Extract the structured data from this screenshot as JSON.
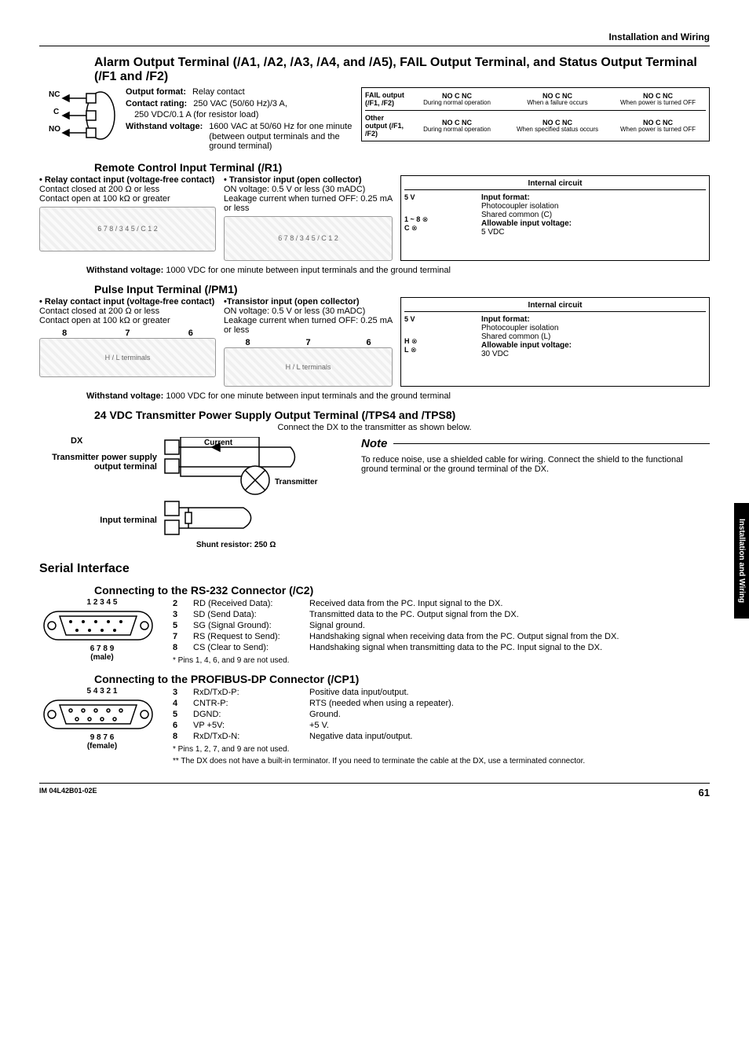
{
  "header": {
    "section": "Installation and Wiring"
  },
  "alarm": {
    "title": "Alarm Output Terminal (/A1, /A2, /A3, /A4, and /A5), FAIL Output Terminal, and Status Output Terminal (/F1 and /F2)",
    "labels": {
      "nc": "NC",
      "c": "C",
      "no": "NO"
    },
    "spec": {
      "output_format_k": "Output format:",
      "output_format_v": "Relay contact",
      "contact_rating_k": "Contact rating:",
      "contact_rating_v1": "250 VAC (50/60 Hz)/3 A,",
      "contact_rating_v2": "250 VDC/0.1 A (for resistor load)",
      "withstand_k": "Withstand voltage:",
      "withstand_v": "1600 VAC at 50/60 Hz for one minute (between output terminals and the ground terminal)"
    },
    "table": {
      "row1_lab": "FAIL output (/F1, /F2)",
      "row2_lab": "Other output (/F1, /F2)",
      "hdr": "NO C NC",
      "c1_1": "During normal operation",
      "c1_2": "When a failure occurs",
      "c1_3": "When power is turned OFF",
      "c2_1": "During normal operation",
      "c2_2": "When specified status occurs",
      "c2_3": "When power is turned OFF"
    }
  },
  "remote": {
    "title": "Remote Control Input Terminal (/R1)",
    "relay_k": "• Relay contact input (voltage-free contact)",
    "relay_v1": "Contact closed at 200 Ω or less",
    "relay_v2": "Contact open at 100 kΩ or greater",
    "trans_k": "• Transistor input (open collector)",
    "trans_v1": "ON voltage: 0.5 V or less (30 mADC)",
    "trans_v2": "Leakage current when turned OFF: 0.25 mA or less",
    "pins": {
      "c": "C",
      "1": "1",
      "2": "2",
      "3": "3",
      "4": "4",
      "5": "5",
      "6": "6",
      "7": "7",
      "8": "8"
    },
    "internal": {
      "title": "Internal circuit",
      "v5": "5 V",
      "range": "1 ~ 8",
      "c": "C",
      "fmt_k": "Input format:",
      "fmt_v1": "Photocoupler isolation",
      "fmt_v2": "Shared common (C)",
      "aiv_k": "Allowable input voltage:",
      "aiv_v": "5 VDC"
    },
    "withstand_k": "Withstand voltage:",
    "withstand_v": "1000 VDC for one minute between input terminals and the ground terminal"
  },
  "pulse": {
    "title": "Pulse Input Terminal (/PM1)",
    "relay_k": "• Relay contact input (voltage-free contact)",
    "relay_v1": "Contact closed at 200 Ω or less",
    "relay_v2": "Contact open at 100 kΩ or greater",
    "trans_k": "•Transistor input (open collector)",
    "trans_v1": "ON voltage: 0.5 V or less (30 mADC)",
    "trans_v2": "Leakage current when turned OFF: 0.25 mA or less",
    "cols": {
      "8": "8",
      "7": "7",
      "6": "6"
    },
    "hl": {
      "h": "H",
      "l": "L"
    },
    "internal": {
      "title": "Internal circuit",
      "v5": "5 V",
      "h": "H",
      "l": "L",
      "fmt_k": "Input format:",
      "fmt_v1": "Photocoupler isolation",
      "fmt_v2": "Shared common (L)",
      "aiv_k": "Allowable input voltage:",
      "aiv_v": "30 VDC"
    },
    "withstand_k": "Withstand voltage:",
    "withstand_v": "1000 VDC for one minute between input terminals and the ground terminal"
  },
  "tps": {
    "title": "24 VDC Transmitter Power Supply Output Terminal (/TPS4 and /TPS8)",
    "sub": "Connect the DX to the transmitter as shown below.",
    "labels": {
      "dx": "DX",
      "current": "Current",
      "tx_power": "Transmitter power supply output terminal",
      "input_term": "Input terminal",
      "shunt": "Shunt resistor: 250 Ω",
      "transmitter": "Transmitter",
      "plus": "+",
      "minus": "–"
    },
    "note_title": "Note",
    "note_body": "To reduce noise, use a shielded cable for wiring. Connect the shield to the functional ground terminal or the ground terminal of the DX."
  },
  "serial": {
    "title": "Serial Interface",
    "rs232": {
      "title": "Connecting to the RS-232 Connector (/C2)",
      "top_pins": "1  2  3  4  5",
      "bot_pins": "6  7  8  9",
      "gender": "(male)",
      "rows": [
        {
          "n": "2",
          "sig": "RD (Received Data):",
          "desc": "Received data from the PC. Input signal to the DX."
        },
        {
          "n": "3",
          "sig": "SD (Send Data):",
          "desc": "Transmitted data to the PC. Output signal from the DX."
        },
        {
          "n": "5",
          "sig": "SG (Signal Ground):",
          "desc": "Signal ground."
        },
        {
          "n": "7",
          "sig": "RS (Request to Send):",
          "desc": "Handshaking signal when receiving data from the PC. Output signal from the DX."
        },
        {
          "n": "8",
          "sig": "CS (Clear to Send):",
          "desc": "Handshaking signal when transmitting data to the PC. Input signal to the DX."
        }
      ],
      "footnote": "* Pins 1, 4, 6, and 9 are not used."
    },
    "profibus": {
      "title": "Connecting to the PROFIBUS-DP Connector (/CP1)",
      "top_pins": "5  4  3  2  1",
      "bot_pins": "9  8  7  6",
      "gender": "(female)",
      "rows": [
        {
          "n": "3",
          "sig": "RxD/TxD-P:",
          "desc": "Positive data input/output."
        },
        {
          "n": "4",
          "sig": "CNTR-P:",
          "desc": "RTS (needed when using a repeater)."
        },
        {
          "n": "5",
          "sig": "DGND:",
          "desc": "Ground."
        },
        {
          "n": "6",
          "sig": "VP +5V:",
          "desc": "+5 V."
        },
        {
          "n": "8",
          "sig": "RxD/TxD-N:",
          "desc": "Negative data input/output."
        }
      ],
      "fn1": "*   Pins 1, 2, 7, and 9 are not used.",
      "fn2": "**  The DX does not have a built-in terminator. If you need to terminate the cable at the DX, use a terminated connector."
    }
  },
  "sidetab": "Installation and Wiring",
  "footer": {
    "doc": "IM 04L42B01-02E",
    "page": "61"
  }
}
